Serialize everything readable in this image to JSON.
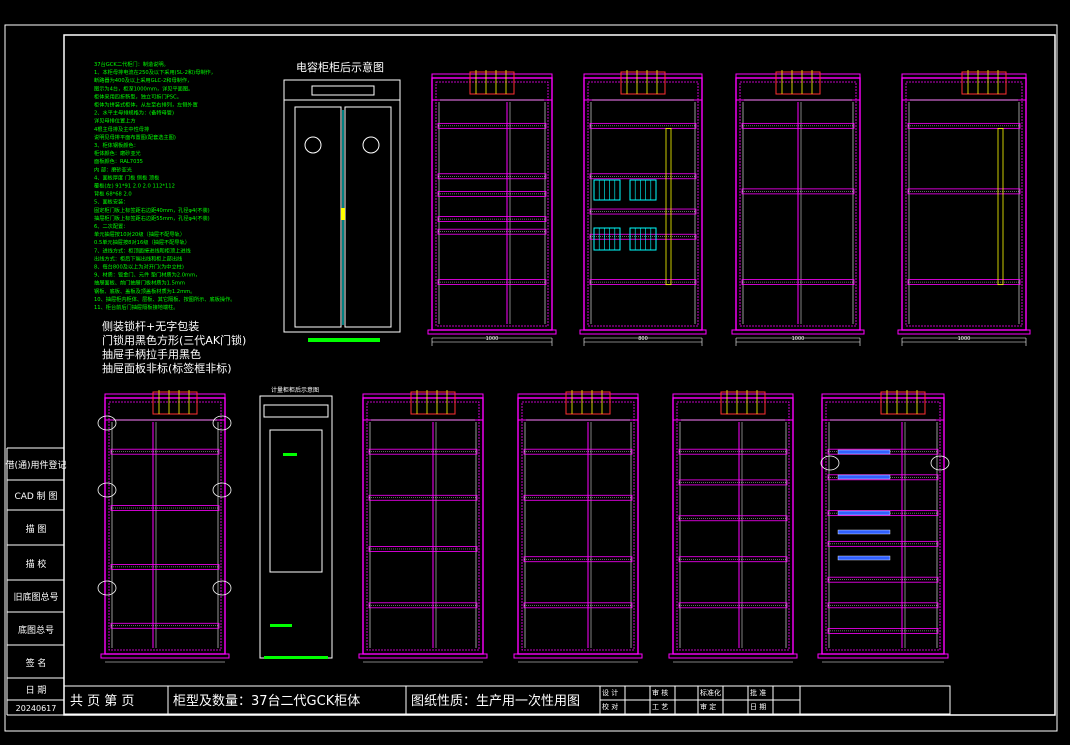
{
  "colors": {
    "background": "#000000",
    "frame": "#ffffff",
    "cabinet": "#ff00ff",
    "notes_text": "#00ff00",
    "highlight": "#00ffff",
    "accent_yellow": "#ffff00",
    "rail_red": "#ff3030"
  },
  "side_labels": [
    "借(通)用件登记",
    "CAD 制 图",
    "描   图",
    "描   校",
    "旧底图总号",
    "底图总号",
    "签   名",
    "日   期",
    "20240617"
  ],
  "title_block": {
    "pages": "共 页 第 页",
    "model_qty": "柜型及数量：37台二代GCK柜体",
    "nature": "图纸性质：生产用一次性用图",
    "sign_cells_row1": [
      "设 计",
      "审 核",
      "标准化",
      "批 准"
    ],
    "sign_cells_row2": [
      "校 对",
      "工 艺",
      "审 定",
      "日 期"
    ]
  },
  "capacitor_title": "电容柜柜后示意图",
  "meter_title": "计量柜柜后示意图",
  "notes_small": [
    "37台GCK二代柜门：制造说明。",
    "1、本柜母排电流在250及以下采用(SL-2和)母制作，",
    "   断路器为400及以上采用GLC-2和母制作，",
    "   图示为4台，柜深1000mm，详见平面图。",
    "   柜体采用四折新型，独立可拆门PSC。",
    "   柜体为拼装式柜体，从左至右排列，左侧外置",
    "2、水平主母排规格为：(备特母管)",
    "   详见母排位置上方",
    "   4根主母排及主中性母排",
    "   说明见母排平面布置图(配套选主图)",
    "3、柜体钢板颜色：",
    "   柜体颜色：磨砂亚光",
    "   面板颜色：RAL7035",
    "   内 部：磨砂亚光",
    "4、面板厚度        门板        侧板        顶板",
    "   覆板(左)     91*91     2.0    2.0     112*112",
    "   背板           68*68     2.0",
    "5、面板安装：",
    "   固定柜门板上标签距右边距40mm，孔径φ4(不装)",
    "   抽屉柜门板上标签距右边距55mm，孔径φ4(不装)",
    "6、二次配置：",
    "   单元抽屉按10对20级（抽屉不配导轨）",
    "   0.5单元抽屉按8对16级（抽屉不配导轨）",
    "7、进线方式：柜顶面接进线和柜顶上进线",
    "   出线方式：柜后下端出线和柜上部出线",
    "8、每台800及以上为对开门(为中立柱)",
    "9、材质：钣金门、元件 垫门材质为2.0mm，",
    "   抽屉面板、前门抽屉门板材质为1.5mm",
    "   钢板、底板、盖板及顶盖板材质为1.2mm。",
    "10、抽屉柜内柜体、层板、其它隔板、按图所示、底板操作。",
    "11、柜台前后门抽屉隔板接地端柱。"
  ],
  "notes_large": [
    "侧装锁杆+无字包装",
    "门锁用黑色方形(三代AK门锁)",
    "抽屉手柄拉手用黑色",
    "抽屉面板非标(标签框非标)"
  ],
  "dim_values": [
    "1000",
    "800",
    "1000",
    "1000"
  ]
}
